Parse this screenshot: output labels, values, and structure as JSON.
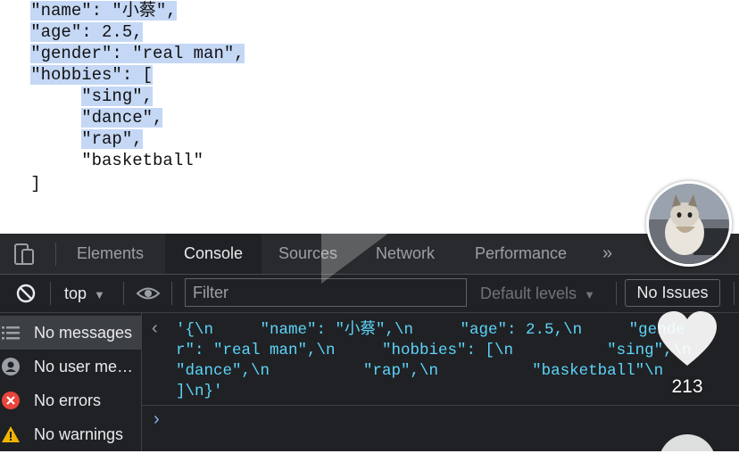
{
  "page": {
    "lines": [
      {
        "indent": "   ",
        "text": "\"name\": \"小蔡\","
      },
      {
        "indent": "   ",
        "text": "\"age\": 2.5,"
      },
      {
        "indent": "   ",
        "text": "\"gender\": \"real man\","
      },
      {
        "indent": "   ",
        "text": "\"hobbies\": ["
      },
      {
        "indent": "        ",
        "text": "\"sing\","
      },
      {
        "indent": "        ",
        "text": "\"dance\","
      },
      {
        "indent": "        ",
        "text": "\"rap\","
      },
      {
        "indent": "        ",
        "text": "\"basketball\""
      },
      {
        "indent": "   ",
        "text": "]"
      }
    ]
  },
  "devtools": {
    "tabs": [
      "Elements",
      "Console",
      "Sources",
      "Network",
      "Performance"
    ],
    "active_tab": "Console",
    "more_tabs": "»",
    "toolbar": {
      "context": "top",
      "filter_placeholder": "Filter",
      "levels": "Default levels",
      "issues": "No Issues"
    },
    "sidebar": [
      {
        "label": "No messages",
        "icon": "list-icon"
      },
      {
        "label": "No user me…",
        "icon": "user-icon"
      },
      {
        "label": "No errors",
        "icon": "error-icon"
      },
      {
        "label": "No warnings",
        "icon": "warning-icon"
      }
    ],
    "output_lines": [
      "'{\\n     \"name\": \"小蔡\",\\n     \"age\": 2.5,\\n     \"gende",
      "r\": \"real man\",\\n     \"hobbies\": [\\n          \"sing\",\\n",
      "\"dance\",\\n          \"rap\",\\n          \"basketball\"\\n",
      "]\\n}'"
    ],
    "return_glyph": "‹",
    "prompt_glyph": "›"
  },
  "overlay": {
    "like_count": "213"
  },
  "colors": {
    "highlight": "#c4d7f5",
    "console_string": "#5cd5fb",
    "devtools_bg": "#202124"
  }
}
